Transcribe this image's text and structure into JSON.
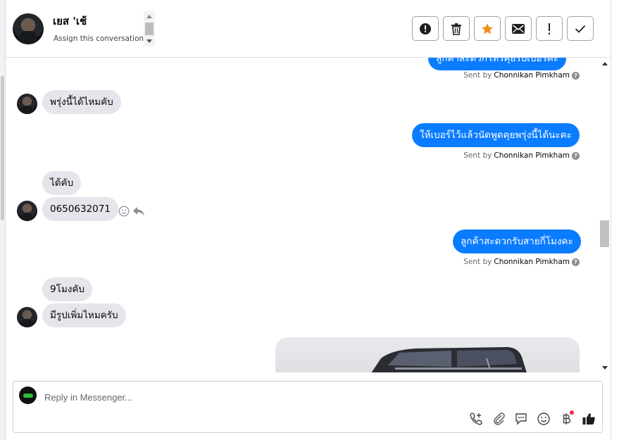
{
  "header": {
    "contact_name": "เยส 'เช้",
    "assign_label": "Assign this conversation",
    "actions": [
      {
        "name": "spam-button",
        "icon": "alert-circle-icon"
      },
      {
        "name": "delete-button",
        "icon": "trash-icon"
      },
      {
        "name": "star-button",
        "icon": "star-icon"
      },
      {
        "name": "mark-unread-button",
        "icon": "envelope-icon"
      },
      {
        "name": "follow-up-button",
        "icon": "exclamation-icon"
      },
      {
        "name": "mark-done-button",
        "icon": "check-icon"
      }
    ]
  },
  "conversation": {
    "cutoff_bubble": "ลูกค้าสะดวกโทรคุยรับเบอร์ค่ะ",
    "sent_by_prefix": "Sent by",
    "agent_name": "Chonnikan Pimkham",
    "messages": [
      {
        "dir": "in",
        "text": "พรุ่งนี้ได้ไหมคับ"
      },
      {
        "dir": "out",
        "text": "ให้เบอร์ไว้แล้วนัดพูดคุยพรุ่งนี้ได้นะคะ"
      },
      {
        "dir": "in",
        "text": "ได้คับ"
      },
      {
        "dir": "in",
        "text": "0650632071"
      },
      {
        "dir": "out",
        "text": "ลูกค้าสะดวกรับสายกี่โมงคะ"
      },
      {
        "dir": "in",
        "text": "9โมงคับ"
      },
      {
        "dir": "in",
        "text": "มีรูปเพิ่มไหมครับ"
      }
    ]
  },
  "composer": {
    "placeholder": "Reply in Messenger...",
    "tools": [
      "phone-add-icon",
      "paperclip-icon",
      "chat-bubble-icon",
      "emoji-icon",
      "baht-icon",
      "thumbs-up-icon"
    ]
  },
  "colors": {
    "accent": "#0a7cff",
    "incoming": "#e4e6eb",
    "star": "#f28d1a",
    "notify": "#f02849"
  }
}
